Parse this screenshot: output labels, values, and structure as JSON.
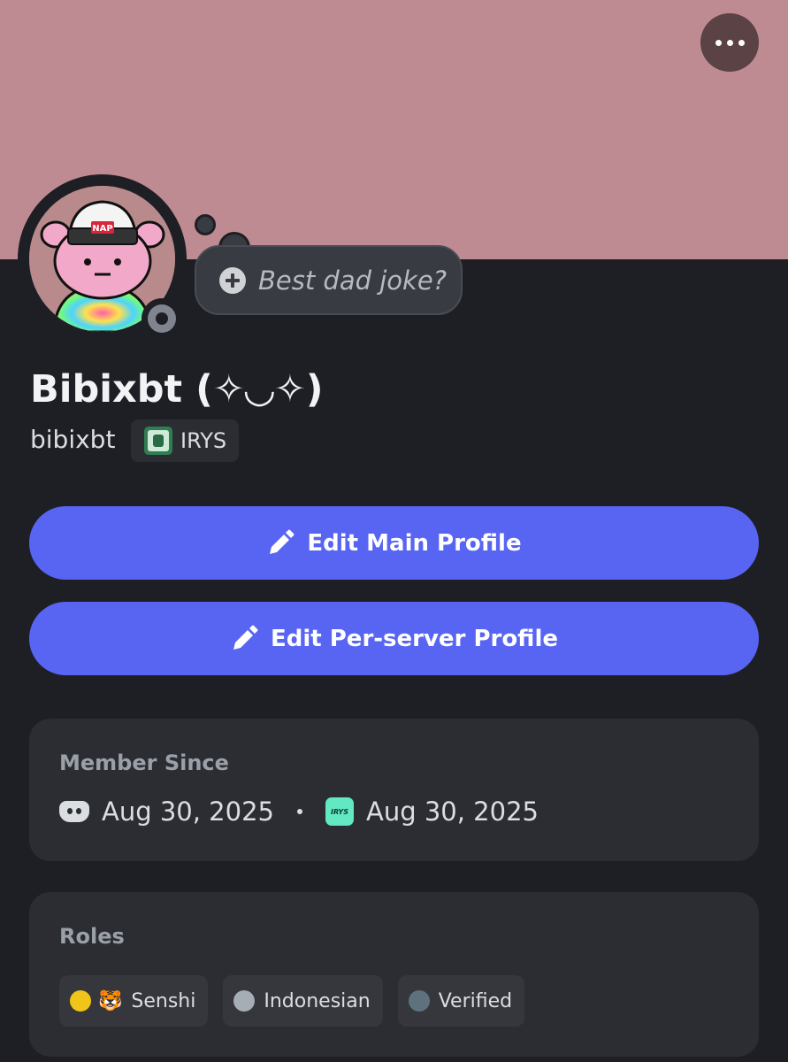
{
  "profile": {
    "display_name": "Bibixbt (✧◡✧)",
    "username": "bibixbt",
    "server_tag": "IRYS",
    "status": "offline",
    "banner_color": "#bf8b93"
  },
  "thought_bubble": {
    "text": "Best dad joke?"
  },
  "actions": {
    "edit_main": "Edit Main Profile",
    "edit_server": "Edit Per-server Profile"
  },
  "member_since": {
    "title": "Member Since",
    "discord_date": "Aug 30, 2025",
    "server_date": "Aug 30, 2025",
    "server_icon_label": "IRYS"
  },
  "roles": {
    "title": "Roles",
    "items": [
      {
        "name": "Senshi",
        "color": "#f0c419",
        "emoji": "🐯"
      },
      {
        "name": "Indonesian",
        "color": "#a5adb5"
      },
      {
        "name": "Verified",
        "color": "#5e727e"
      }
    ]
  },
  "colors": {
    "accent": "#5865f2",
    "background": "#1e1f24",
    "card": "#2b2d33"
  }
}
